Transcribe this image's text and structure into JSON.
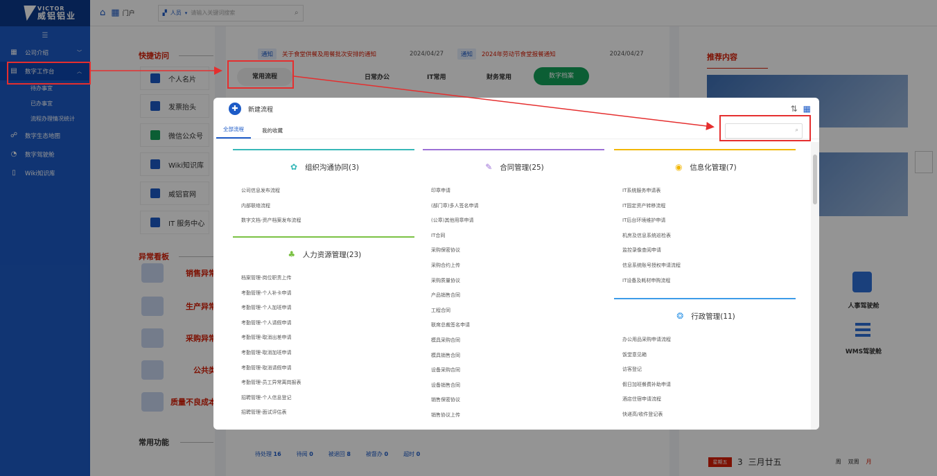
{
  "brand": {
    "name_en": "VICTOR",
    "name_cn": "威铝铝业"
  },
  "topbar": {
    "portal_label": "门户",
    "search_scope": "人员",
    "search_placeholder": "请输入关键词搜索"
  },
  "sidebar": {
    "items": [
      {
        "label": "公司介绍",
        "icon": "building-icon",
        "chevron": "﹀"
      },
      {
        "label": "数字工作台",
        "icon": "desk-icon",
        "chevron": "︿"
      },
      {
        "label": "待办事宜",
        "sub": true
      },
      {
        "label": "已办事宜",
        "sub": true
      },
      {
        "label": "流程办理情况统计",
        "sub": true
      },
      {
        "label": "数字生态地图",
        "icon": "network-icon"
      },
      {
        "label": "数字驾驶舱",
        "icon": "gauge-icon"
      },
      {
        "label": "Wiki知识库",
        "icon": "book-icon"
      }
    ]
  },
  "workspace": {
    "quick_title": "快捷访问",
    "quick_items": [
      "个人名片",
      "发票抬头",
      "微信公众号",
      "Wiki知识库",
      "威铝官网",
      "IT 服务中心"
    ],
    "abnormal_title": "异常看板",
    "abnormal_items": [
      "销售异常",
      "生产异常",
      "采购异常",
      "公共类",
      "质量不良成本"
    ],
    "common_title": "常用功能",
    "notices": [
      {
        "tag": "通知",
        "text": "关于食堂供餐及用餐批次安排的通知",
        "date": "2024/04/27"
      },
      {
        "tag": "通知",
        "text": "2024年劳动节食堂报餐通知",
        "date": "2024/04/27"
      }
    ],
    "tabs": [
      "常用流程",
      "日常办公",
      "IT常用",
      "财务常用",
      "数字档案"
    ],
    "recommend_title": "推荐内容",
    "cockpits": [
      "人事驾驶舱",
      "WMS驾驶舱"
    ],
    "todo_items": [
      {
        "label": "待处理",
        "count": "16"
      },
      {
        "label": "待阅",
        "count": "0"
      },
      {
        "label": "被退回",
        "count": "8"
      },
      {
        "label": "被督办",
        "count": "0"
      },
      {
        "label": "超时",
        "count": "0"
      }
    ],
    "calendar": {
      "weekday": "星期五",
      "day": "3",
      "lunar": "三月廿五",
      "views": [
        "周",
        "双周",
        "月"
      ]
    }
  },
  "modal": {
    "title": "新建流程",
    "tabs": [
      "全部流程",
      "我的收藏"
    ],
    "categories": [
      {
        "title": "组织沟通协同(3)",
        "color": "#36b8b8",
        "icon": "team-icon",
        "glyph": "✿",
        "items": [
          "公司信息发布流程",
          "内部联络流程",
          "数字文档-资产档案发布流程"
        ]
      },
      {
        "title": "人力资源管理(23)",
        "color": "#7ac143",
        "icon": "org-chart-icon",
        "glyph": "♣",
        "items": [
          "档案管理-岗位职责上传",
          "考勤管理-个人补卡申请",
          "考勤管理-个人加班申请",
          "考勤管理-个人请假申请",
          "考勤管理-取消出差申请",
          "考勤管理-取消加班申请",
          "考勤管理-取消请假申请",
          "考勤管理-员工异常离岗报表",
          "招聘管理-个人信息登记",
          "招聘管理-面试评估表"
        ]
      },
      {
        "title": "合同管理(25)",
        "color": "#9b6fd6",
        "icon": "edit-icon",
        "glyph": "✎",
        "items": [
          "印章申请",
          "(部门章)多人签名申请",
          "(公章)其他用章申请",
          "IT合同",
          "采购保密协议",
          "采购合约上传",
          "采购质量协议",
          "产品销售合同",
          "工程合同",
          "联席总裁签名申请",
          "模具采购合同",
          "模具销售合同",
          "设备采购合同",
          "设备销售合同",
          "销售保密协议",
          "销售协议上传"
        ]
      },
      {
        "title": "信息化管理(7)",
        "color": "#f2b705",
        "icon": "info-circle-icon",
        "glyph": "◉",
        "items": [
          "IT系统服务申请表",
          "IT固定资产转移流程",
          "IT后台环境维护申请",
          "机房及信息系统巡检表",
          "监控录像查阅申请",
          "信息系统账号授权申请流程",
          "IT设备及耗材申购流程"
        ]
      },
      {
        "title": "行政管理(11)",
        "color": "#3c9be8",
        "icon": "admin-circle-icon",
        "glyph": "❂",
        "items": [
          "办公用品采购申请流程",
          "饭堂意见箱",
          "访客登记",
          "假日加班餐费补助申请",
          "酒店住宿申请流程",
          "快递高/收件登记表"
        ]
      }
    ]
  }
}
